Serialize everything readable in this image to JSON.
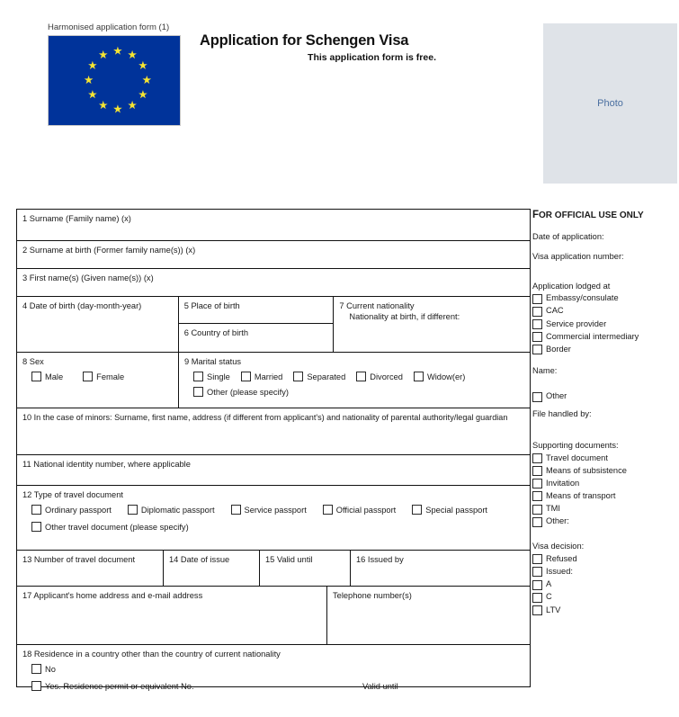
{
  "header": {
    "harmonised_label": "Harmonised application form (1)",
    "title": "Application for Schengen Visa",
    "subtitle": "This application form is free.",
    "photo_placeholder": "Photo",
    "flag_color": "#00339a",
    "star_color": "#f5e432",
    "photo_bg": "#dfe3e8",
    "photo_text_color": "#4a6fa0"
  },
  "fields": {
    "f1": "1  Surname (Family name) (x)",
    "f2": "2  Surname at birth (Former family name(s)) (x)",
    "f3": "3  First name(s) (Given name(s)) (x)",
    "f4": "4  Date of birth (day-month-year)",
    "f5": "5  Place of birth",
    "f6": "6  Country of birth",
    "f7_line1": "7  Current nationality",
    "f7_line2": "Nationality at birth, if different:",
    "f8": "8  Sex",
    "f9": "9  Marital status",
    "f10": "10  In the case of minors: Surname, first name, address (if different from applicant's) and nationality of parental authority/legal guardian",
    "f11": "11  National identity number, where applicable",
    "f12": "12  Type of travel document",
    "f13": "13  Number of travel document",
    "f14": "14  Date of issue",
    "f15": "15  Valid until",
    "f16": "16  Issued by",
    "f17": "17  Applicant's home address and e-mail address",
    "f17_phone": "Telephone number(s)",
    "f18": "18  Residence in a country other than the country of current nationality",
    "f18_valid_until": "Valid until"
  },
  "sex_options": [
    "Male",
    "Female"
  ],
  "marital_options_row1": [
    "Single",
    "Married",
    "Separated",
    "Divorced",
    "Widow(er)"
  ],
  "marital_options_row2": [
    "Other (please specify)"
  ],
  "travel_doc_row1": [
    "Ordinary passport",
    "Diplomatic passport",
    "Service passport",
    "Official passport",
    "Special passport"
  ],
  "travel_doc_row2": [
    "Other travel document (please specify)"
  ],
  "residence_options": [
    "No",
    "Yes. Residence permit or equivalent  No."
  ],
  "official": {
    "title_cap": "F",
    "title_rest": "OR OFFICIAL USE ONLY",
    "date_of_application": "Date of application:",
    "visa_application_number": "Visa application number:",
    "lodged_at_head": "Application lodged at",
    "lodged_at_options": [
      "Embassy/consulate",
      "CAC",
      "Service provider",
      "Commercial intermediary",
      "Border"
    ],
    "name_label": "Name:",
    "other_option": "Other",
    "file_handled_by": "File handled by:",
    "supporting_head": "Supporting documents:",
    "supporting_options": [
      "Travel document",
      "Means of subsistence",
      "Invitation",
      "Means of transport",
      "TMI",
      "Other:"
    ],
    "visa_decision_head": "Visa decision:",
    "visa_decision_options": [
      "Refused",
      "Issued:",
      "A",
      "C",
      "LTV"
    ]
  }
}
